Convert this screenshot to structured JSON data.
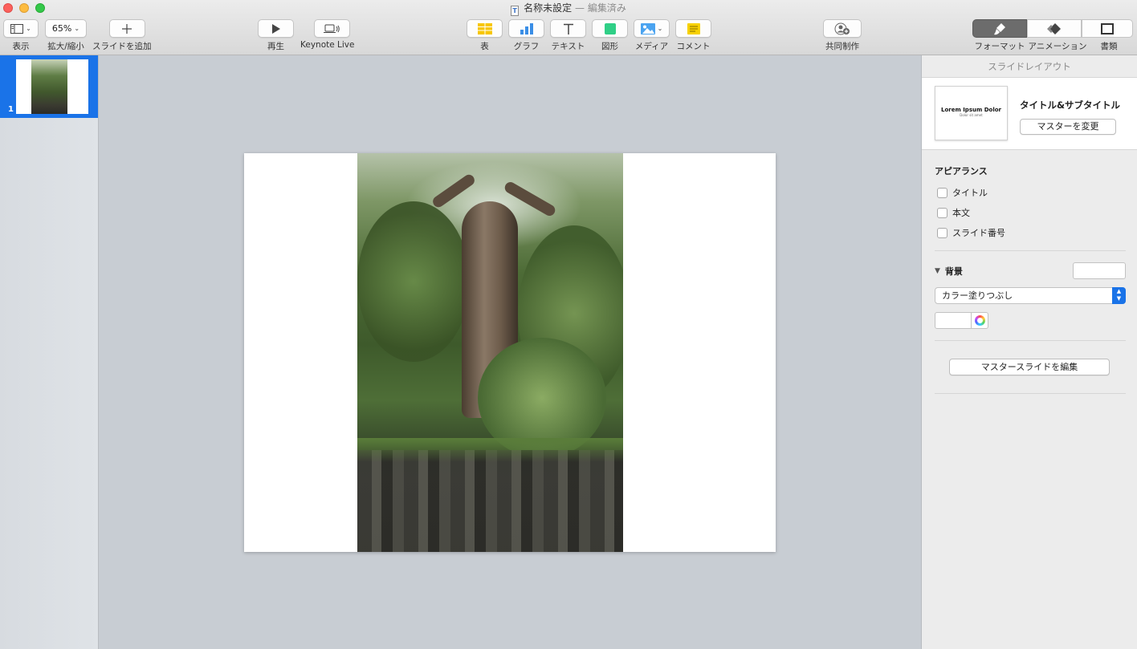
{
  "window": {
    "title": "名称未設定",
    "status": "— 編集済み",
    "doc_icon_glyph": "T"
  },
  "toolbar": {
    "view_label": "表示",
    "zoom_value": "65%",
    "zoom_label": "拡大/縮小",
    "add_slide_label": "スライドを追加",
    "play_label": "再生",
    "keynote_live_label": "Keynote Live",
    "table_label": "表",
    "chart_label": "グラフ",
    "text_label": "テキスト",
    "shape_label": "図形",
    "media_label": "メディア",
    "comment_label": "コメント",
    "collaborate_label": "共同制作",
    "format_label": "フォーマット",
    "animation_label": "アニメーション",
    "document_label": "書類",
    "icons": {
      "view": "sidebar-view-icon",
      "play": "play-icon",
      "keynote_live": "laptop-broadcast-icon",
      "table": "table-icon",
      "chart": "bar-chart-icon",
      "text": "text-icon",
      "shape": "square-shape-icon",
      "media": "photo-icon",
      "comment": "comment-note-icon",
      "collaborate": "add-person-icon",
      "format": "paintbrush-icon",
      "animation": "diamond-animation-icon",
      "document": "document-icon"
    }
  },
  "navigator": {
    "slides": [
      {
        "number": "1",
        "selected": true
      }
    ],
    "selection_color": "#1a73e8"
  },
  "inspector": {
    "header": "スライドレイアウト",
    "layout_thumb_title": "Lorem Ipsum Dolor",
    "layout_thumb_subtitle": "Dolor sit amet",
    "layout_name": "タイトル&サブタイトル",
    "change_master_label": "マスターを変更",
    "appearance_title": "アピアランス",
    "appearance_options": [
      {
        "label": "タイトル",
        "checked": false
      },
      {
        "label": "本文",
        "checked": false
      },
      {
        "label": "スライド番号",
        "checked": false
      }
    ],
    "background_title": "背景",
    "fill_type": "カラー塗りつぶし",
    "fill_color": "#ffffff",
    "edit_master_label": "マスタースライドを編集"
  }
}
